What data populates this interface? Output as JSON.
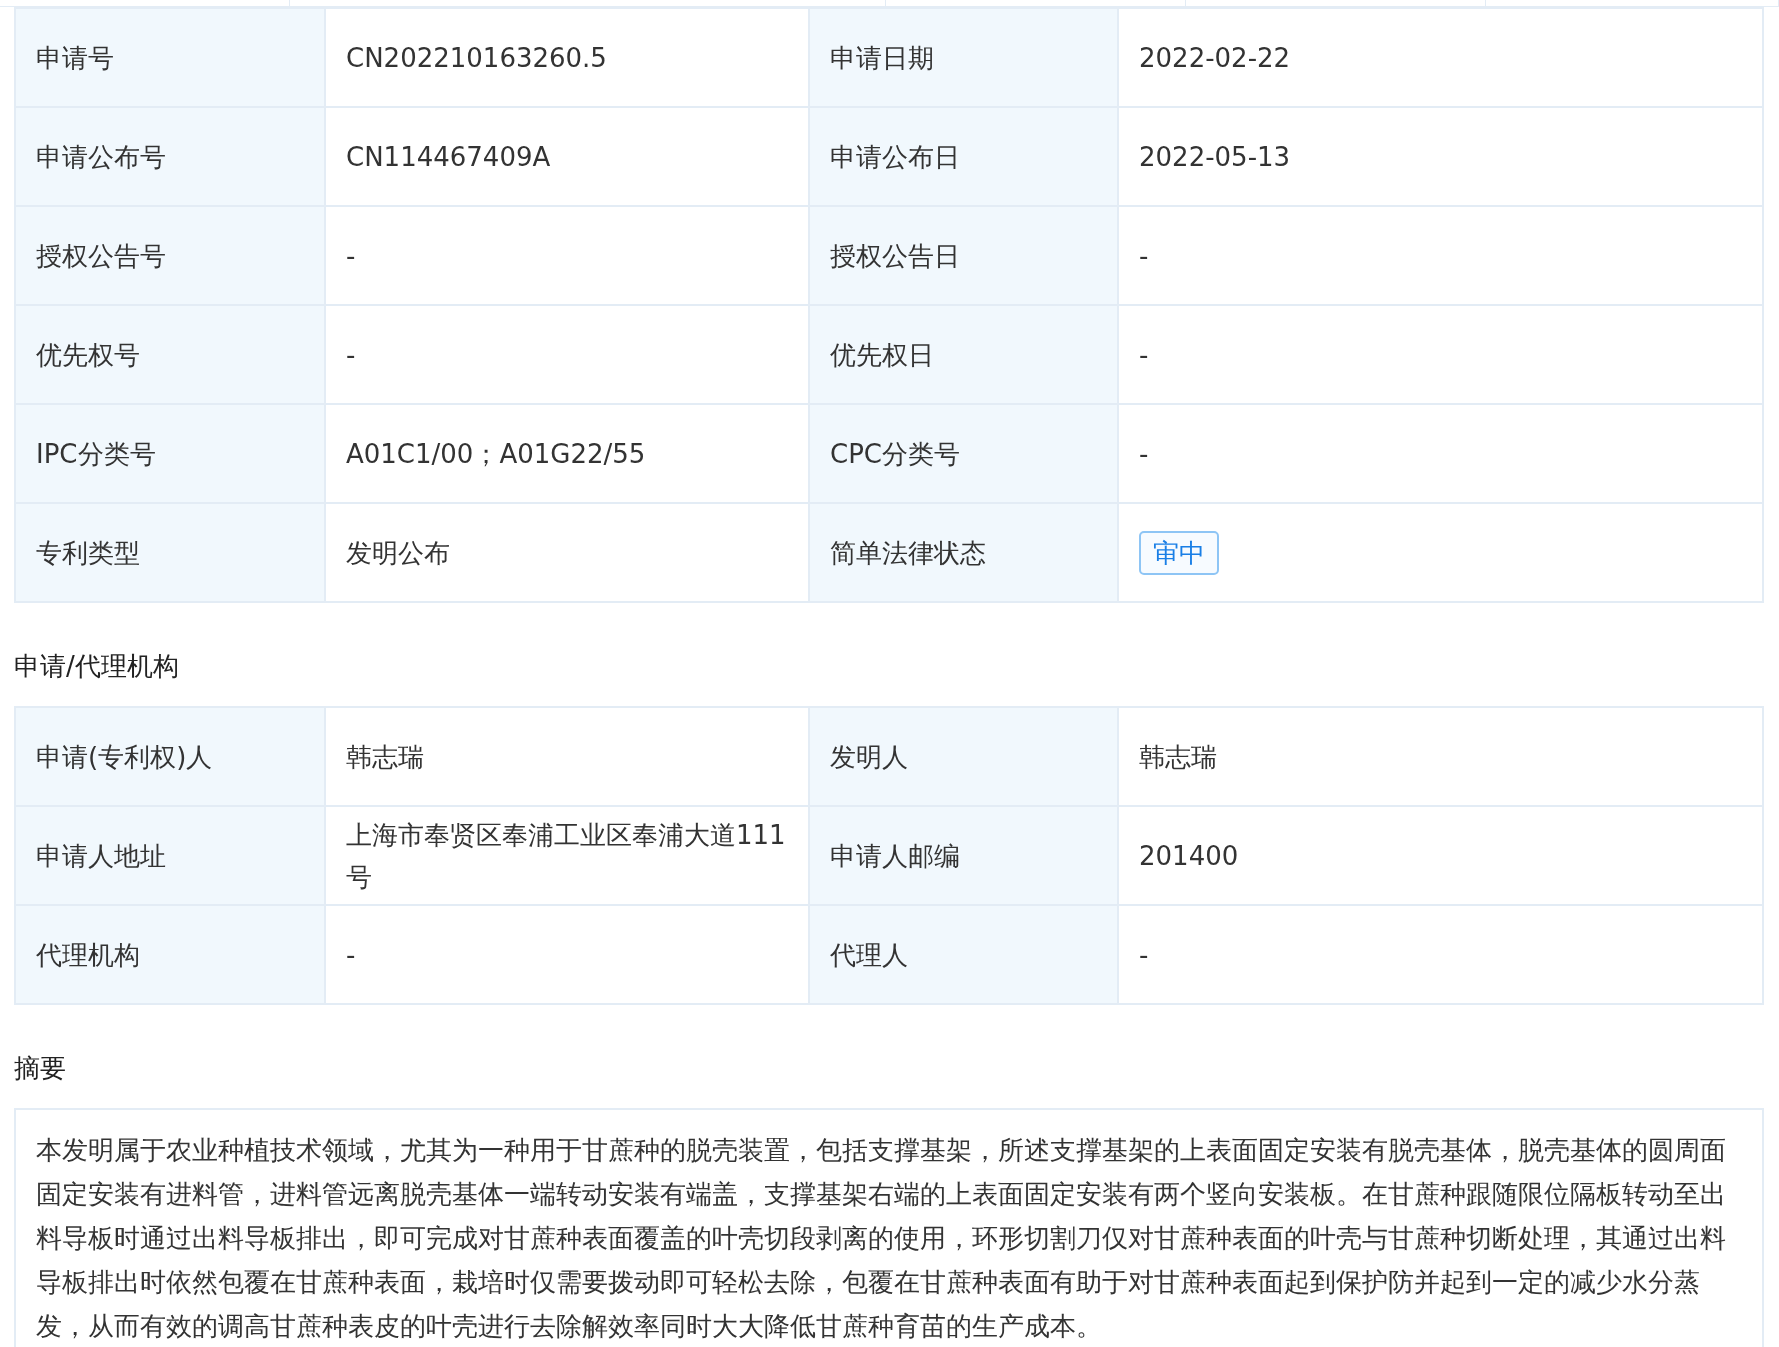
{
  "basic_info": {
    "rows": [
      [
        {
          "label": "申请号",
          "value": "CN202210163260.5"
        },
        {
          "label": "申请日期",
          "value": "2022-02-22"
        }
      ],
      [
        {
          "label": "申请公布号",
          "value": "CN114467409A"
        },
        {
          "label": "申请公布日",
          "value": "2022-05-13"
        }
      ],
      [
        {
          "label": "授权公告号",
          "value": "-"
        },
        {
          "label": "授权公告日",
          "value": "-"
        }
      ],
      [
        {
          "label": "优先权号",
          "value": "-"
        },
        {
          "label": "优先权日",
          "value": "-"
        }
      ],
      [
        {
          "label": "IPC分类号",
          "value": "A01C1/00；A01G22/55"
        },
        {
          "label": "CPC分类号",
          "value": "-"
        }
      ],
      [
        {
          "label": "专利类型",
          "value": "发明公布"
        },
        {
          "label": "简单法律状态",
          "value": "审中",
          "kind": "tag"
        }
      ]
    ]
  },
  "agency": {
    "title": "申请/代理机构",
    "rows": [
      [
        {
          "label": "申请(专利权)人",
          "value": "韩志瑞"
        },
        {
          "label": "发明人",
          "value": "韩志瑞"
        }
      ],
      [
        {
          "label": "申请人地址",
          "value": "上海市奉贤区奉浦工业区奉浦大道111号"
        },
        {
          "label": "申请人邮编",
          "value": "201400"
        }
      ],
      [
        {
          "label": "代理机构",
          "value": "-"
        },
        {
          "label": "代理人",
          "value": "-"
        }
      ]
    ]
  },
  "abstract": {
    "title": "摘要",
    "text": "本发明属于农业种植技术领域，尤其为一种用于甘蔗种的脱壳装置，包括支撑基架，所述支撑基架的上表面固定安装有脱壳基体，脱壳基体的圆周面固定安装有进料管，进料管远离脱壳基体一端转动安装有端盖，支撑基架右端的上表面固定安装有两个竖向安装板。在甘蔗种跟随限位隔板转动至出料导板时通过出料导板排出，即可完成对甘蔗种表面覆盖的叶壳切段剥离的使用，环形切割刀仅对甘蔗种表面的叶壳与甘蔗种切断处理，其通过出料导板排出时依然包覆在甘蔗种表面，栽培时仅需要拨动即可轻松去除，包覆在甘蔗种表面有助于对甘蔗种表面起到保护防并起到一定的减少水分蒸发，从而有效的调高甘蔗种表皮的叶壳进行去除解效率同时大大降低甘蔗种育苗的生产成本。"
  }
}
